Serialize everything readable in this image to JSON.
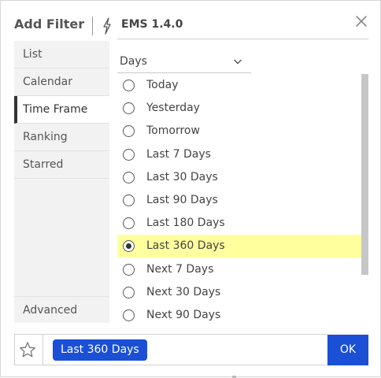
{
  "header": {
    "title": "Add Filter",
    "app_label": "EMS 1.4.0",
    "icons": {
      "app": "bolt-icon",
      "close": "close-icon"
    }
  },
  "sidebar": {
    "items": [
      {
        "label": "List",
        "active": false
      },
      {
        "label": "Calendar",
        "active": false
      },
      {
        "label": "Time Frame",
        "active": true
      },
      {
        "label": "Ranking",
        "active": false
      },
      {
        "label": "Starred",
        "active": false
      }
    ],
    "advanced_label": "Advanced"
  },
  "filter": {
    "unit_select": {
      "value": "Days",
      "icon": "chevron-down-icon"
    },
    "options": [
      {
        "label": "Today",
        "selected": false
      },
      {
        "label": "Yesterday",
        "selected": false
      },
      {
        "label": "Tomorrow",
        "selected": false
      },
      {
        "label": "Last 7 Days",
        "selected": false
      },
      {
        "label": "Last 30 Days",
        "selected": false
      },
      {
        "label": "Last 90 Days",
        "selected": false
      },
      {
        "label": "Last 180 Days",
        "selected": false
      },
      {
        "label": "Last 360 Days",
        "selected": true
      },
      {
        "label": "Next 7 Days",
        "selected": false
      },
      {
        "label": "Next 30 Days",
        "selected": false
      },
      {
        "label": "Next 90 Days",
        "selected": false
      }
    ]
  },
  "footer": {
    "star_icon": "star-icon",
    "selected_chip": "Last 360 Days",
    "ok_label": "OK"
  },
  "colors": {
    "accent": "#1a4fd6",
    "highlight": "#ffff9e",
    "sidebar_bg": "#f2f2f2"
  }
}
